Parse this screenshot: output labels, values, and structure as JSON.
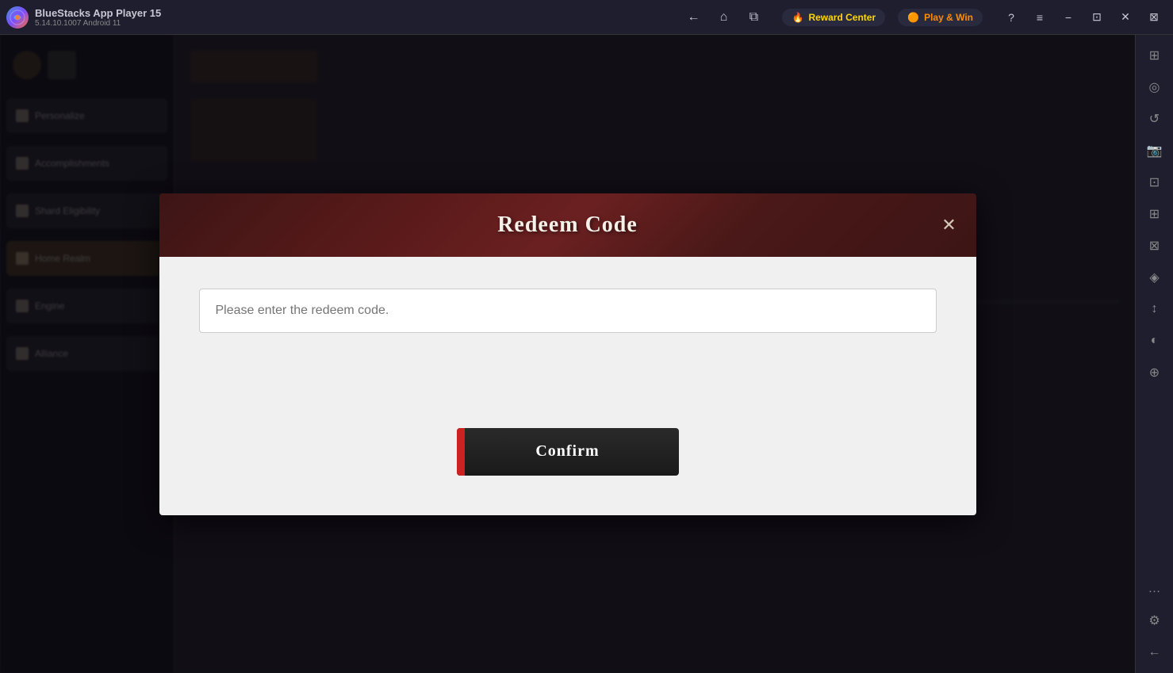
{
  "titlebar": {
    "app_name": "BlueStacks App Player 15",
    "app_version": "5.14.10.1007  Android 11",
    "reward_center_label": "Reward Center",
    "play_win_label": "Play & Win",
    "logo_text": "BS",
    "nav": {
      "back": "←",
      "home": "⌂",
      "tabs": "⧉"
    },
    "window_controls": {
      "help": "?",
      "menu": "≡",
      "minimize": "−",
      "restore": "⊡",
      "close": "✕",
      "snap": "⊠"
    }
  },
  "sidebar": {
    "icons": [
      "▶",
      "◎",
      "⊞",
      "⊟",
      "⊠",
      "◈",
      "◉",
      "⊗",
      "◐",
      "◑",
      "⊕",
      "…",
      "⚙",
      "←"
    ]
  },
  "background_panel": {
    "items": [
      {
        "label": "Personalize",
        "active": false
      },
      {
        "label": "",
        "active": false
      },
      {
        "label": "Accomplishments",
        "active": false
      },
      {
        "label": "Shard Eligibility",
        "active": false
      },
      {
        "label": "Home Realm",
        "active": true
      },
      {
        "label": "Engine",
        "active": false
      },
      {
        "label": "Alliance",
        "active": false
      }
    ]
  },
  "modal": {
    "title": "Redeem Code",
    "close_label": "✕",
    "input_placeholder": "Please enter the redeem code.",
    "confirm_button_label": "Confirm",
    "confirm_button_accent": "|"
  }
}
